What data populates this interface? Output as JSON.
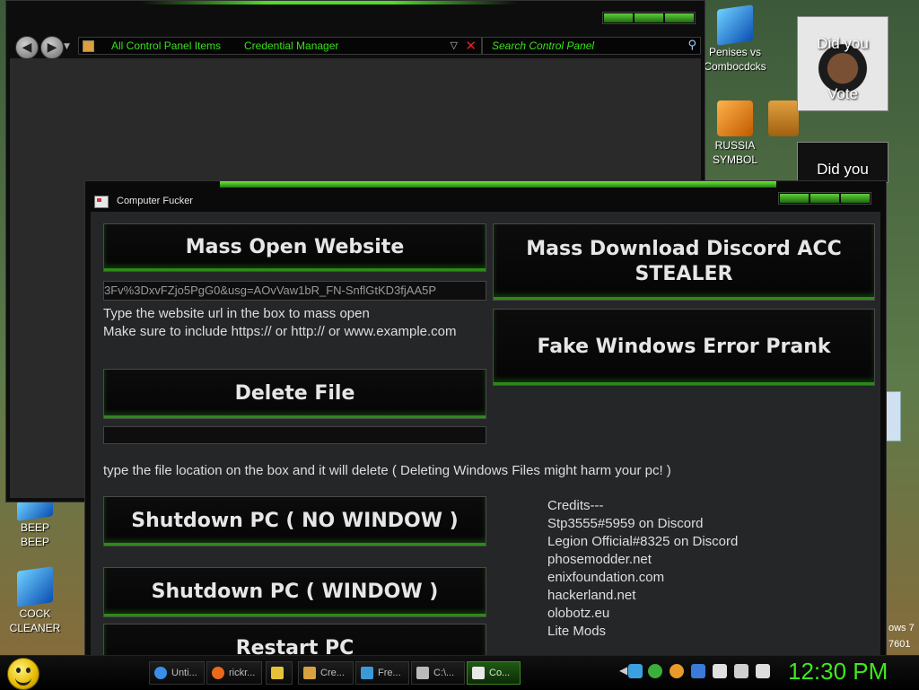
{
  "explorer": {
    "breadcrumb": [
      "All Control Panel Items",
      "Credential Manager"
    ],
    "search_placeholder": "Search Control Panel"
  },
  "desktop": {
    "icons_right": [
      {
        "label_line1": "Penises vs",
        "label_line2": "Combocdcks"
      },
      {
        "label_line1": "RUSSIA",
        "label_line2": "SYMBOL"
      }
    ],
    "icons_left": [
      {
        "label_line1": "BEEP",
        "label_line2": "BEEP"
      },
      {
        "label_line1": "COCK",
        "label_line2": "CLEANER"
      }
    ],
    "gadget_caption_top": "Did you",
    "gadget_caption_bottom": "Vote",
    "gadget2_caption": "Did you",
    "partial_text": "ows 7",
    "partial_text2": "7601"
  },
  "app": {
    "title": "Computer Fucker",
    "buttons": {
      "mass_open": "Mass Open Website",
      "mass_download_line1": "Mass Download Discord ACC",
      "mass_download_line2": "STEALER",
      "fake_error": "Fake Windows Error Prank",
      "delete_file": "Delete File",
      "shutdown_no_window": "Shutdown PC ( NO WINDOW )",
      "shutdown_window": "Shutdown PC ( WINDOW )",
      "restart": "Restart PC"
    },
    "url_input_value": "3Fv%3DxvFZjo5PgG0&usg=AOvVaw1bR_FN-SnflGtKD3fjAA5P",
    "file_input_value": "",
    "url_help_line1": "Type the website url in the box to mass open",
    "url_help_line2": "Make sure to include https:// or http://  or www.example.com",
    "file_help": "type the file location on the box and it will delete ( Deleting Windows Files might harm your pc! )",
    "credits": [
      "Credits---",
      "Stp3555#5959 on Discord",
      "Legion Official#8325 on Discord",
      "phosemodder.net",
      "enixfoundation.com",
      "hackerland.net",
      "olobotz.eu",
      "Lite Mods"
    ]
  },
  "taskbar": {
    "items": [
      {
        "label": "Unti...",
        "color": "#3a8ee8"
      },
      {
        "label": "rickr...",
        "color": "#e86a1a"
      },
      {
        "label": "",
        "color": "#e6c23a"
      },
      {
        "label": "Cre...",
        "color": "#d8a040"
      },
      {
        "label": "Fre...",
        "color": "#3a9ad8"
      },
      {
        "label": "C:\\...",
        "color": "#bbbbbb"
      },
      {
        "label": "Co...",
        "color": "#e8e8e8"
      }
    ],
    "clock": "12:30 PM"
  },
  "colors": {
    "accent_green": "#3fe81e",
    "window_bg": "#0a0a0a",
    "client_bg": "#252628"
  }
}
